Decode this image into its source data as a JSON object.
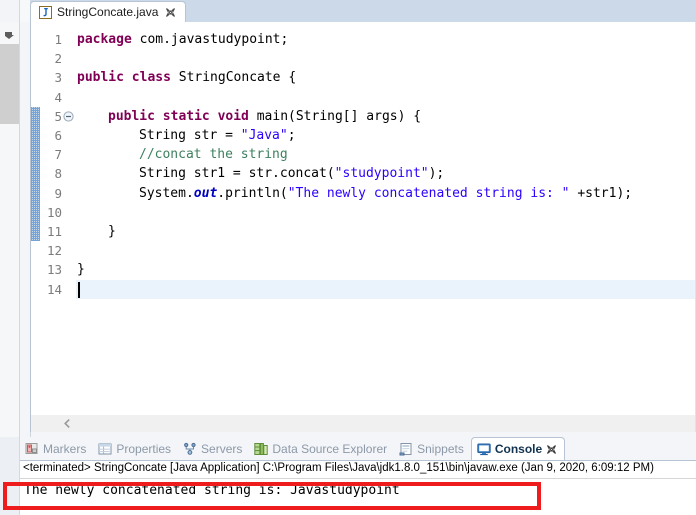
{
  "window": {
    "app": "Eclipse IDE"
  },
  "editor": {
    "tab": {
      "label": "StringConcate.java",
      "icon": "java-file-icon",
      "close_icon": "close-icon"
    },
    "gutter": {
      "line_numbers": [
        "1",
        "2",
        "3",
        "4",
        "5",
        "6",
        "7",
        "8",
        "9",
        "10",
        "11",
        "12",
        "13",
        "14"
      ],
      "fold_marker_line": "5",
      "fold_icon": "collapse-minus-icon",
      "change_bar_from_line": 5,
      "change_bar_to_line": 11
    },
    "highlighted_line": 14,
    "scroll": {
      "left_arrow_icon": "chevron-left-icon"
    },
    "code_lines": [
      {
        "n": 1,
        "indent": 0,
        "tokens": [
          {
            "t": "package",
            "c": "kw"
          },
          {
            "t": " com.javastudypoint;",
            "c": "plain"
          }
        ]
      },
      {
        "n": 2,
        "indent": 0,
        "tokens": []
      },
      {
        "n": 3,
        "indent": 0,
        "tokens": [
          {
            "t": "public class",
            "c": "kw"
          },
          {
            "t": " StringConcate {",
            "c": "plain"
          }
        ]
      },
      {
        "n": 4,
        "indent": 0,
        "tokens": []
      },
      {
        "n": 5,
        "indent": 1,
        "tokens": [
          {
            "t": "public static void",
            "c": "kw"
          },
          {
            "t": " main(String[] args) {",
            "c": "plain"
          }
        ]
      },
      {
        "n": 6,
        "indent": 2,
        "tokens": [
          {
            "t": "String str = ",
            "c": "plain"
          },
          {
            "t": "\"Java\"",
            "c": "str"
          },
          {
            "t": ";",
            "c": "plain"
          }
        ]
      },
      {
        "n": 7,
        "indent": 2,
        "tokens": [
          {
            "t": "//concat the string",
            "c": "cmt"
          }
        ]
      },
      {
        "n": 8,
        "indent": 2,
        "tokens": [
          {
            "t": "String str1 = str.concat(",
            "c": "plain"
          },
          {
            "t": "\"studypoint\"",
            "c": "str"
          },
          {
            "t": ");",
            "c": "plain"
          }
        ]
      },
      {
        "n": 9,
        "indent": 2,
        "tokens": [
          {
            "t": "System.",
            "c": "plain"
          },
          {
            "t": "out",
            "c": "fld"
          },
          {
            "t": ".println(",
            "c": "plain"
          },
          {
            "t": "\"The newly concatenated string is: \"",
            "c": "str"
          },
          {
            "t": " +str1);",
            "c": "plain"
          }
        ]
      },
      {
        "n": 10,
        "indent": 0,
        "tokens": []
      },
      {
        "n": 11,
        "indent": 1,
        "tokens": [
          {
            "t": "}",
            "c": "plain"
          }
        ]
      },
      {
        "n": 12,
        "indent": 0,
        "tokens": []
      },
      {
        "n": 13,
        "indent": 0,
        "tokens": [
          {
            "t": "}",
            "c": "plain"
          }
        ]
      },
      {
        "n": 14,
        "indent": 0,
        "tokens": []
      }
    ]
  },
  "bottom_view": {
    "tabs": [
      {
        "label": "Markers",
        "icon": "markers-icon",
        "active": false,
        "closable": false
      },
      {
        "label": "Properties",
        "icon": "properties-icon",
        "active": false,
        "closable": false
      },
      {
        "label": "Servers",
        "icon": "servers-icon",
        "active": false,
        "closable": false
      },
      {
        "label": "Data Source Explorer",
        "icon": "data-source-explorer-icon",
        "active": false,
        "closable": false
      },
      {
        "label": "Snippets",
        "icon": "snippets-icon",
        "active": false,
        "closable": false
      },
      {
        "label": "Console",
        "icon": "console-monitor-icon",
        "active": true,
        "closable": true,
        "close_icon": "close-icon"
      }
    ]
  },
  "console": {
    "status_line": "<terminated> StringConcate [Java Application] C:\\Program Files\\Java\\jdk1.8.0_151\\bin\\javaw.exe (Jan 9, 2020, 6:09:12 PM)",
    "output": "The newly concatenated string is: Javastudypoint"
  },
  "annotation": {
    "highlight_box_color": "#ee1c1c"
  },
  "colors": {
    "tabbar_bg": "#ccd9e8",
    "keyword": "#7f0055",
    "string": "#2a00ff",
    "comment": "#3f7f5f",
    "field": "#0000c0",
    "current_line": "#eaf2fb",
    "change_bar": "#5d93d0"
  }
}
